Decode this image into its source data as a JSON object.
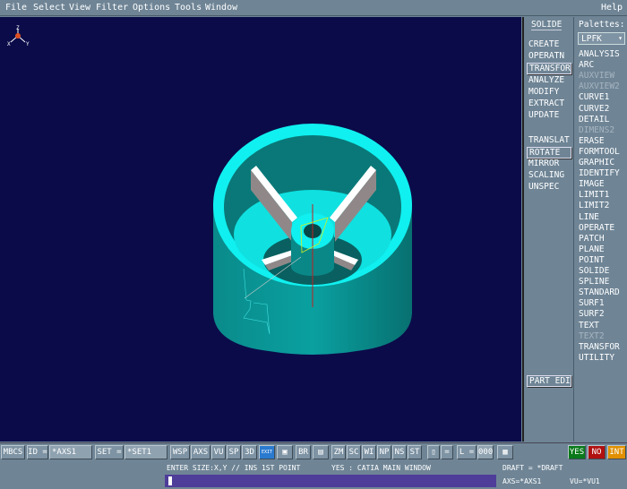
{
  "menubar": {
    "items": [
      "File",
      "Select",
      "View",
      "Filter",
      "Options",
      "Tools",
      "Window"
    ],
    "help": "Help"
  },
  "solide": {
    "title": "SOLIDE",
    "items": [
      "CREATE",
      "OPERATN",
      "TRANSFOR",
      "ANALYZE",
      "MODIFY",
      "EXTRACT",
      "UPDATE"
    ],
    "selected": "TRANSFOR",
    "sub_items": [
      "TRANSLAT",
      "ROTATE",
      "MIRROR",
      "SCALING",
      "UNSPEC"
    ],
    "sub_selected": "ROTATE",
    "part_edit": "PART EDI"
  },
  "palettes": {
    "title": "Palettes:",
    "selected": "LPFK",
    "items": [
      {
        "label": "ANALYSIS",
        "enabled": true
      },
      {
        "label": "ARC",
        "enabled": true
      },
      {
        "label": "AUXVIEW",
        "enabled": false
      },
      {
        "label": "AUXVIEW2",
        "enabled": false
      },
      {
        "label": "CURVE1",
        "enabled": true
      },
      {
        "label": "CURVE2",
        "enabled": true
      },
      {
        "label": "DETAIL",
        "enabled": true
      },
      {
        "label": "DIMENS2",
        "enabled": false
      },
      {
        "label": "ERASE",
        "enabled": true
      },
      {
        "label": "FORMTOOL",
        "enabled": true
      },
      {
        "label": "GRAPHIC",
        "enabled": true
      },
      {
        "label": "IDENTIFY",
        "enabled": true
      },
      {
        "label": "IMAGE",
        "enabled": true
      },
      {
        "label": "LIMIT1",
        "enabled": true
      },
      {
        "label": "LIMIT2",
        "enabled": true
      },
      {
        "label": "LINE",
        "enabled": true
      },
      {
        "label": "OPERATE",
        "enabled": true
      },
      {
        "label": "PATCH",
        "enabled": true
      },
      {
        "label": "PLANE",
        "enabled": true
      },
      {
        "label": "POINT",
        "enabled": true
      },
      {
        "label": "SOLIDE",
        "enabled": true
      },
      {
        "label": "SPLINE",
        "enabled": true
      },
      {
        "label": "STANDARD",
        "enabled": true
      },
      {
        "label": "SURF1",
        "enabled": true
      },
      {
        "label": "SURF2",
        "enabled": true
      },
      {
        "label": "TEXT",
        "enabled": true
      },
      {
        "label": "TEXT2",
        "enabled": false
      },
      {
        "label": "TRANSFOR",
        "enabled": true
      },
      {
        "label": "UTILITY",
        "enabled": true
      }
    ]
  },
  "viewport": {
    "axis_labels": [
      "Z",
      "X",
      "Y"
    ]
  },
  "toolbar": {
    "mbcs": "MBCS",
    "id_label": "ID =",
    "id_value": "*AXS1",
    "set_label": "SET =",
    "set_value": "*SET1",
    "buttons": [
      "WSP",
      "AXS",
      "VU",
      "SP",
      "3D"
    ],
    "exit": "EXIT",
    "br": "BR",
    "buttons2": [
      "ZM",
      "SC",
      "WI",
      "NP",
      "NS",
      "ST"
    ],
    "eq": "=",
    "l_label": "L =",
    "l_value": "000",
    "yes": "YES",
    "no": "NO",
    "int": "INT"
  },
  "status": {
    "prompt": "ENTER SIZE:X,Y // INS 1ST POINT",
    "yes_msg": "YES : CATIA MAIN WINDOW",
    "draft": "DRAFT = *DRAFT",
    "axs": "AXS=*AXS1",
    "vu": "VU=*VU1",
    "input": ""
  },
  "colors": {
    "viewport": "#0b0b4a",
    "part": "#00e6e6",
    "yes": "#0a7a1a",
    "no": "#b01010",
    "int": "#e09000"
  }
}
